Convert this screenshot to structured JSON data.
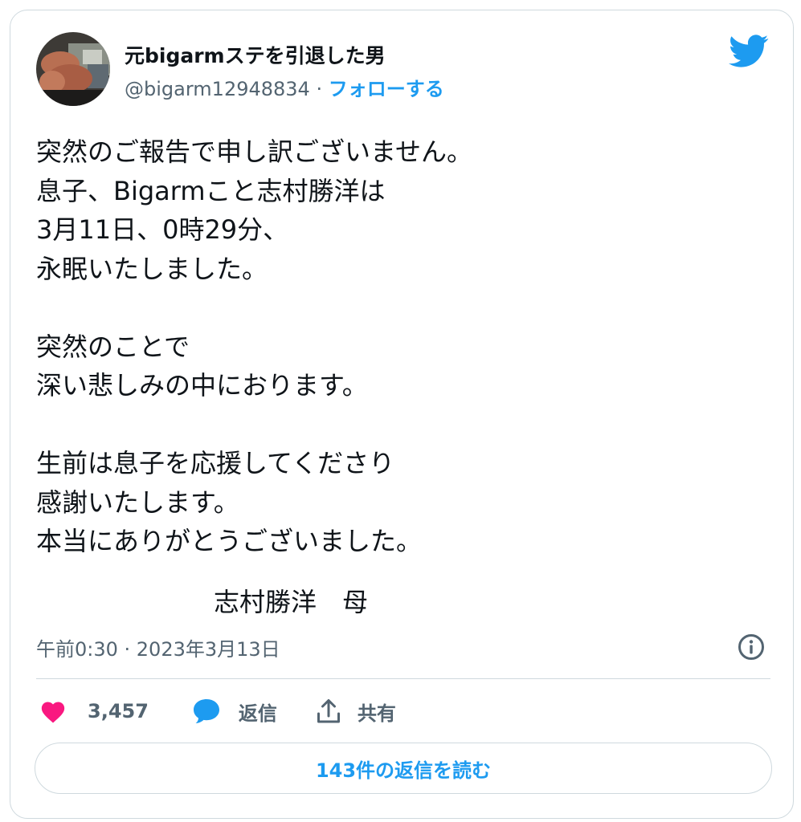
{
  "author": {
    "display_name": "元bigarmステを引退した男",
    "handle": "@bigarm12948834",
    "separator": " · ",
    "follow_label": "フォローする"
  },
  "tweet": {
    "lines": [
      "突然のご報告で申し訳ございません。",
      "息子、Bigarmこと志村勝洋は",
      "3月11日、0時29分、",
      "永眠いたしました。",
      "",
      "突然のことで",
      "深い悲しみの中におります。",
      "",
      "生前は息子を応援してくださり",
      "感謝いたします。",
      "本当にありがとうございました。"
    ],
    "signature": "志村勝洋　母",
    "timestamp": "午前0:30 · 2023年3月13日"
  },
  "actions": {
    "like_count": "3,457",
    "reply_label": "返信",
    "share_label": "共有"
  },
  "read_replies_label": "143件の返信を読む",
  "icons": {
    "brand": "twitter-bird-icon",
    "info": "info-icon",
    "like": "heart-icon",
    "reply": "speech-bubble-icon",
    "share": "share-upload-icon"
  },
  "colors": {
    "accent": "#1d9bf0",
    "like": "#f91880",
    "text": "#0f1419",
    "secondary": "#536471",
    "border": "#cfd9de"
  }
}
